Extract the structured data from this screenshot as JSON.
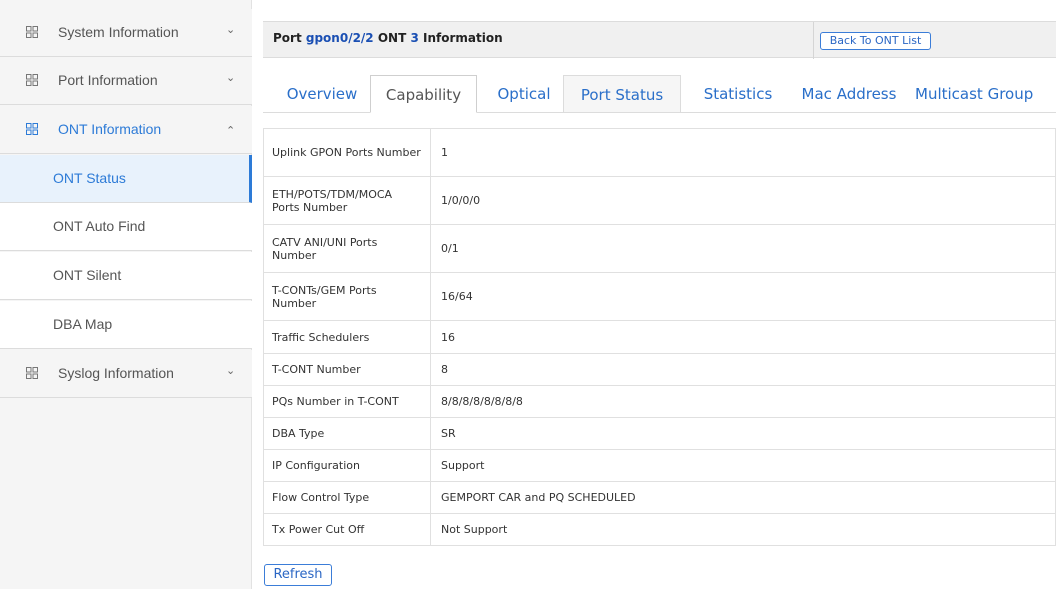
{
  "sidebar": {
    "groups": [
      {
        "label": "System Information",
        "icon": "grid-icon",
        "chevron": "chevron-down-icon"
      },
      {
        "label": "Port Information",
        "icon": "grid-icon",
        "chevron": "chevron-down-icon"
      },
      {
        "label": "ONT Information",
        "icon": "grid-icon",
        "chevron": "chevron-up-icon"
      },
      {
        "label": "Syslog Information",
        "icon": "grid-icon",
        "chevron": "chevron-down-icon"
      }
    ],
    "ont_items": [
      {
        "label": "ONT Status"
      },
      {
        "label": "ONT Auto Find"
      },
      {
        "label": "ONT Silent"
      },
      {
        "label": "DBA Map"
      }
    ],
    "chevron_down": "⌄",
    "chevron_up": "⌃"
  },
  "header": {
    "prefix": "Port ",
    "port": "gpon0/2/2",
    "mid": " ONT ",
    "ont_id": "3",
    "suffix": " Information",
    "back_button": "Back To ONT List"
  },
  "tabs": [
    {
      "label": "Overview"
    },
    {
      "label": "Capability"
    },
    {
      "label": "Optical"
    },
    {
      "label": "Port Status"
    },
    {
      "label": "Statistics"
    },
    {
      "label": "Mac Address"
    },
    {
      "label": "Multicast Group"
    }
  ],
  "capability_rows": [
    {
      "key": "Uplink GPON Ports Number",
      "value": "1"
    },
    {
      "key": "ETH/POTS/TDM/MOCA Ports Number",
      "value": "1/0/0/0"
    },
    {
      "key": "CATV ANI/UNI Ports Number",
      "value": "0/1"
    },
    {
      "key": "T-CONTs/GEM Ports Number",
      "value": "16/64"
    },
    {
      "key": "Traffic Schedulers",
      "value": "16"
    },
    {
      "key": "T-CONT Number",
      "value": "8"
    },
    {
      "key": "PQs Number in T-CONT",
      "value": "8/8/8/8/8/8/8/8"
    },
    {
      "key": "DBA Type",
      "value": "SR"
    },
    {
      "key": "IP Configuration",
      "value": "Support"
    },
    {
      "key": "Flow Control Type",
      "value": "GEMPORT CAR and PQ SCHEDULED"
    },
    {
      "key": "Tx Power Cut Off",
      "value": "Not Support"
    }
  ],
  "refresh_button": "Refresh",
  "colors": {
    "accent": "#2d7bd7",
    "link": "#1a4fb3"
  }
}
